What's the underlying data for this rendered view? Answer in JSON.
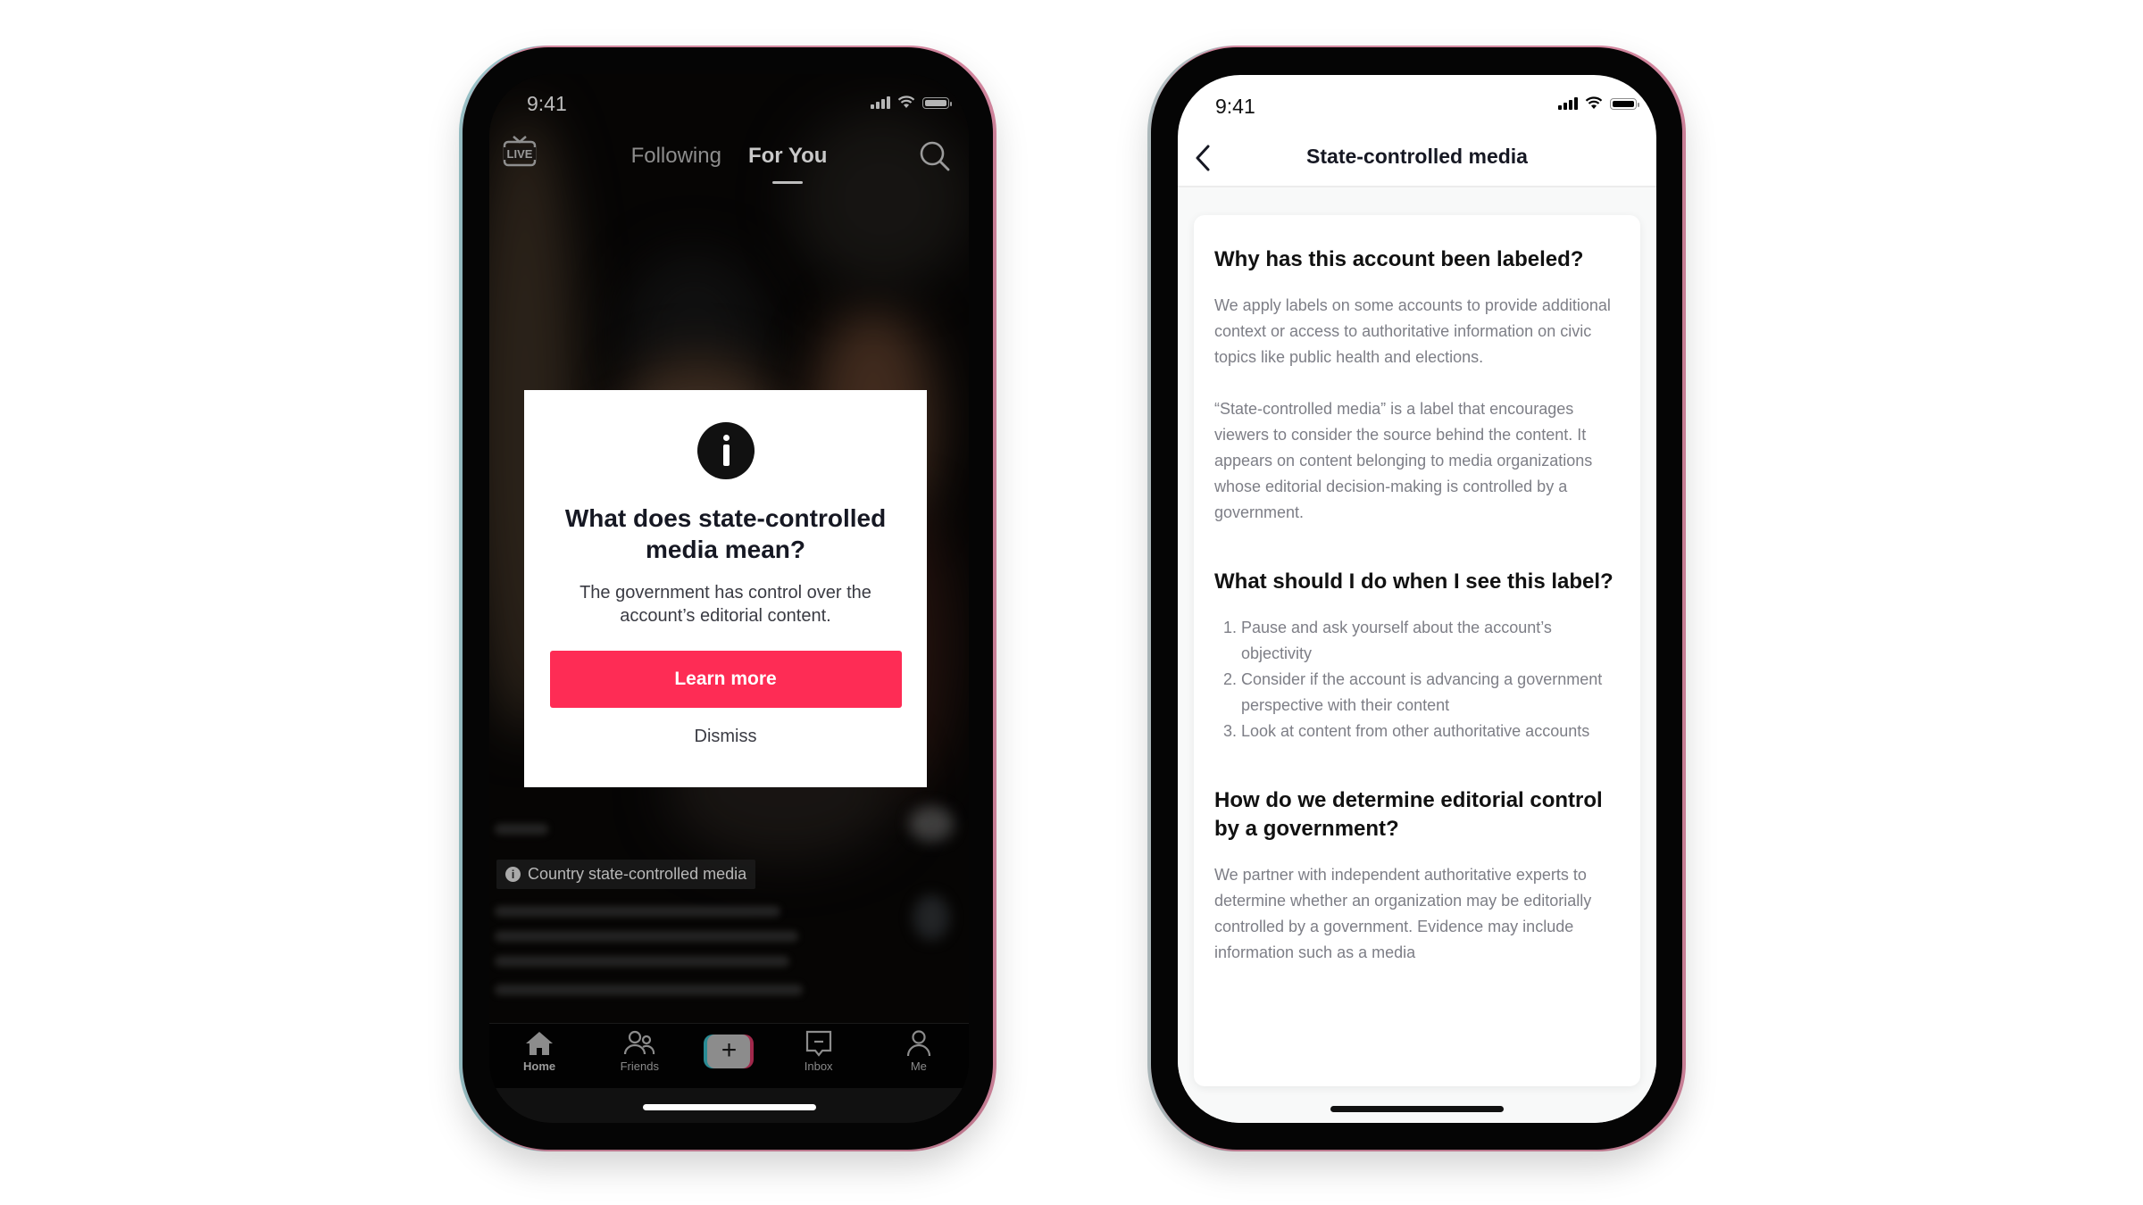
{
  "left_phone": {
    "status_bar": {
      "time": "9:41"
    },
    "top_nav": {
      "live_label": "LIVE",
      "tabs": [
        {
          "label": "Following",
          "active": false
        },
        {
          "label": "For You",
          "active": true
        }
      ],
      "search_icon": "search-icon"
    },
    "dialog": {
      "icon": "info-icon",
      "title": "What does state-controlled media mean?",
      "description": "The government has control over the account’s editorial content.",
      "primary_button": "Learn more",
      "secondary_button": "Dismiss"
    },
    "caption_badge": {
      "icon": "info-icon",
      "label": "Country state-controlled media"
    },
    "bottom_nav": {
      "items": [
        {
          "label": "Home",
          "icon": "home-icon",
          "active": true
        },
        {
          "label": "Friends",
          "icon": "friends-icon",
          "active": false
        },
        {
          "label": "",
          "icon": "create-plus-icon",
          "active": false
        },
        {
          "label": "Inbox",
          "icon": "inbox-icon",
          "active": false
        },
        {
          "label": "Me",
          "icon": "profile-icon",
          "active": false
        }
      ]
    }
  },
  "right_phone": {
    "status_bar": {
      "time": "9:41"
    },
    "header": {
      "title": "State-controlled media"
    },
    "sections": [
      {
        "heading": "Why has this account been labeled?",
        "paragraphs": [
          "We apply labels on some accounts to provide additional context or access to authoritative information on civic topics like public health and elections.",
          "“State-controlled media” is a label that encourages viewers to consider the source behind the content. It appears on content belonging to media organizations whose editorial decision-making is controlled by a government."
        ]
      },
      {
        "heading": "What should I do when I see this label?",
        "list": [
          "Pause and ask yourself about the account’s objectivity",
          "Consider if the account is advancing a government perspective with their content",
          "Look at content from other authoritative accounts"
        ]
      },
      {
        "heading": "How do we determine editorial control by a government?",
        "paragraphs": [
          "We partner with independent authoritative experts to determine whether an organization may be editorially controlled by a government. Evidence may include information such as a media"
        ]
      }
    ]
  },
  "colors": {
    "accent": "#FE2C55",
    "dialog_text": "#161823",
    "body_text_gray": "#7d7e86"
  }
}
